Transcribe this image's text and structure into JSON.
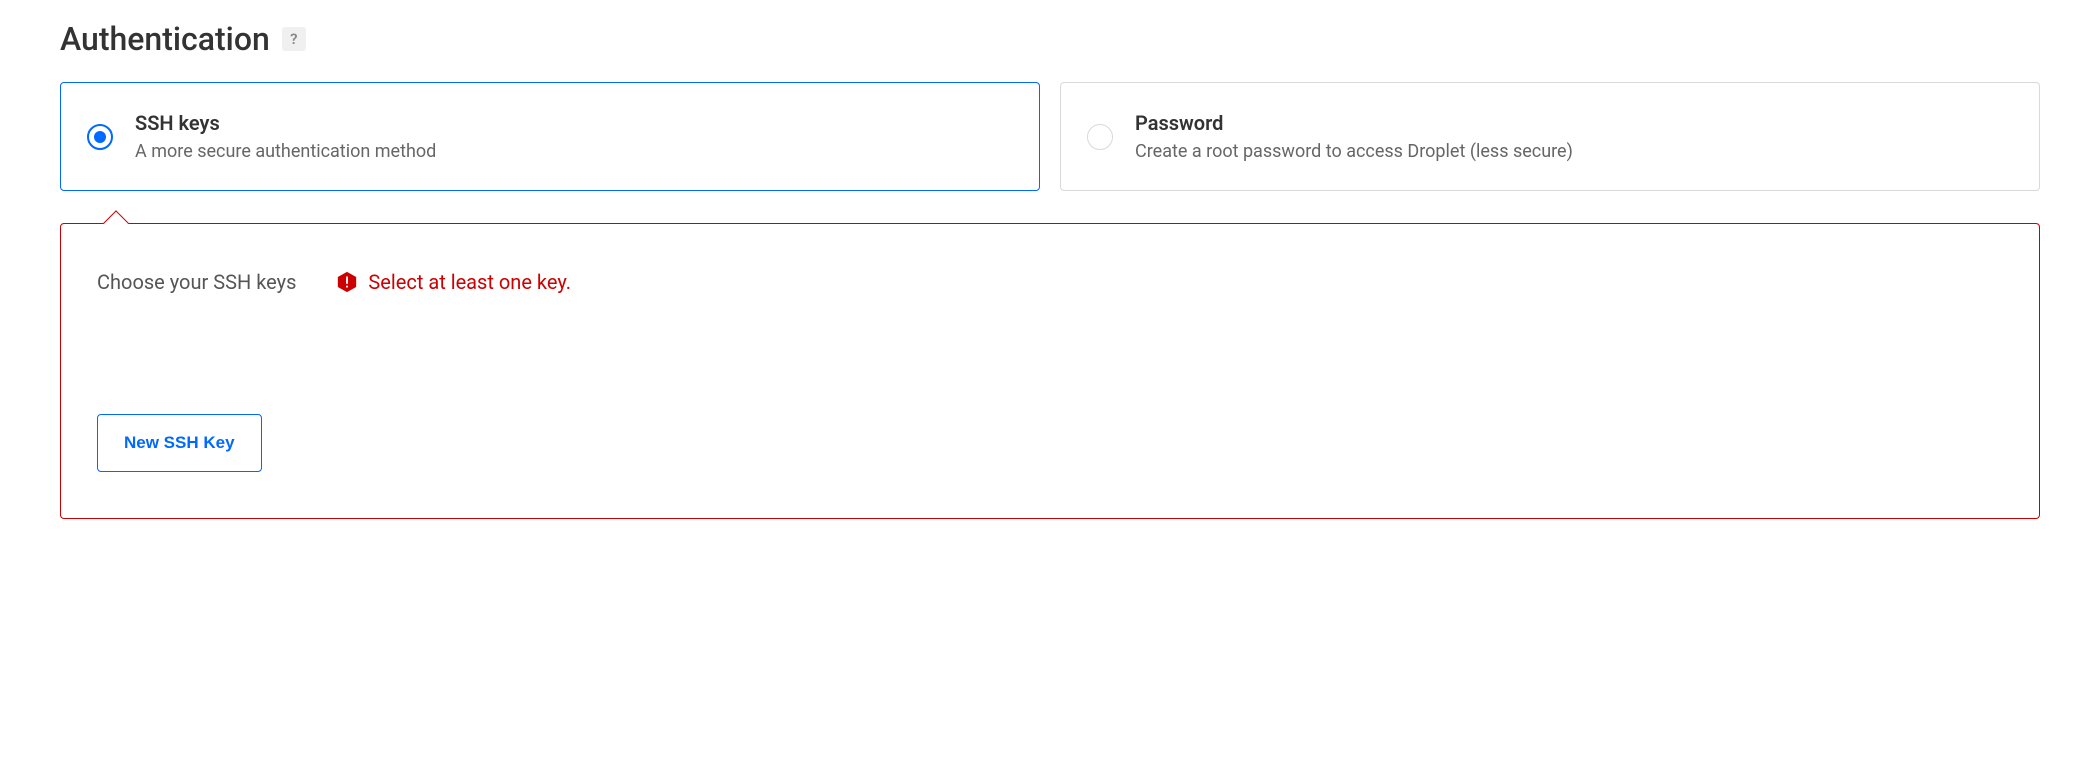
{
  "section": {
    "title": "Authentication",
    "help_symbol": "?"
  },
  "auth_options": {
    "ssh": {
      "title": "SSH keys",
      "desc": "A more secure authentication method"
    },
    "password": {
      "title": "Password",
      "desc": "Create a root password to access Droplet (less secure)"
    }
  },
  "panel": {
    "choose_label": "Choose your SSH keys",
    "error_msg": "Select at least one key.",
    "new_key_btn": "New SSH Key"
  }
}
